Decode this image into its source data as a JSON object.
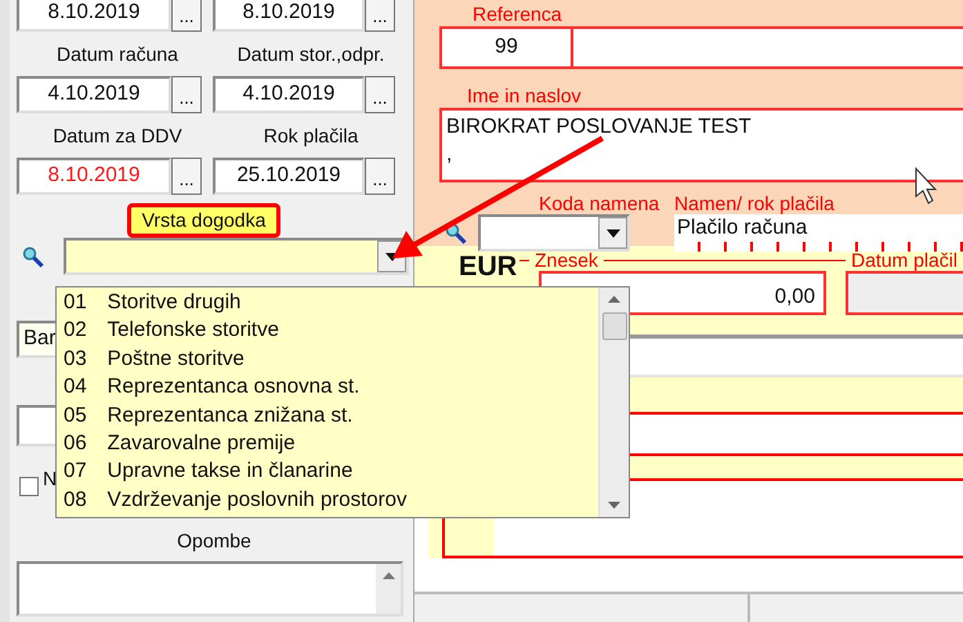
{
  "date_pairs": [
    {
      "fields": [
        {
          "value": "8.10.2019",
          "red": false
        },
        {
          "value": "8.10.2019",
          "red": false
        }
      ]
    },
    {
      "labels": [
        "Datum računa",
        "Datum stor.,odpr."
      ],
      "fields": [
        {
          "value": "4.10.2019",
          "red": false
        },
        {
          "value": "4.10.2019",
          "red": false
        }
      ]
    },
    {
      "labels": [
        "Datum za DDV",
        "Rok plačila"
      ],
      "fields": [
        {
          "value": "8.10.2019",
          "red": true
        },
        {
          "value": "25.10.2019",
          "red": false
        }
      ]
    }
  ],
  "button_text": "...",
  "event_type": {
    "label": "Vrsta dogodka",
    "highlighted": true,
    "expanded": true,
    "options": [
      {
        "code": "01",
        "name": "Storitve drugih"
      },
      {
        "code": "02",
        "name": "Telefonske storitve"
      },
      {
        "code": "03",
        "name": "Poštne storitve"
      },
      {
        "code": "04",
        "name": "Reprezentanca osnovna st."
      },
      {
        "code": "05",
        "name": "Reprezentanca znižana st."
      },
      {
        "code": "06",
        "name": "Zavarovalne premije"
      },
      {
        "code": "07",
        "name": "Upravne takse in članarine"
      },
      {
        "code": "08",
        "name": "Vzdrževanje poslovnih prostorov"
      }
    ]
  },
  "bank_combo": {
    "value": "Bar"
  },
  "checkbox": {
    "label": "N",
    "checked": false
  },
  "notes": {
    "label": "Opombe"
  },
  "reference": {
    "label": "Referenca",
    "value": "99"
  },
  "name_address": {
    "label": "Ime in naslov",
    "lines": [
      "BIROKRAT POSLOVANJE TEST",
      ","
    ]
  },
  "purpose_code": {
    "label": "Koda namena"
  },
  "purpose": {
    "label": "Namen/ rok plačila",
    "value": "Plačilo računa"
  },
  "amount": {
    "label": "Znesek",
    "currency": "EUR",
    "value": "0,00"
  },
  "payment_date": {
    "label": "Datum plačil"
  }
}
